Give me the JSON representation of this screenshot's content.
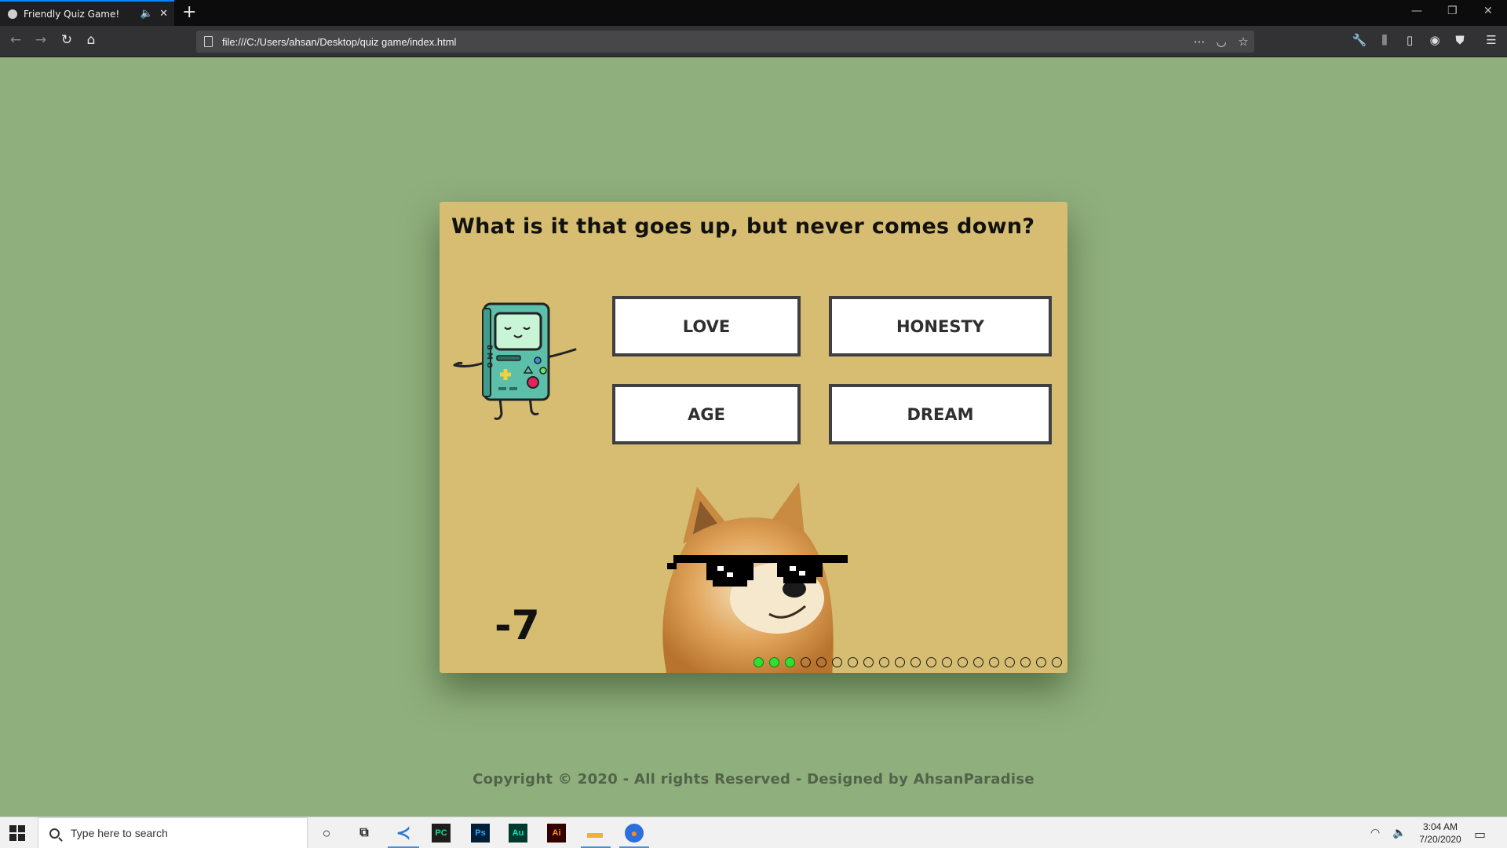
{
  "browser": {
    "tab_title": "Friendly Quiz Game!",
    "url": "file:///C:/Users/ahsan/Desktop/quiz game/index.html"
  },
  "quiz": {
    "question": "What is it that goes up, but never comes down?",
    "options": [
      "LOVE",
      "HONESTY",
      "AGE",
      "DREAM"
    ],
    "score": "-7",
    "progress": {
      "answered": 3,
      "total": 20
    },
    "colors": {
      "card": "#d6bd72",
      "background": "#8faf7c",
      "progress_done": "#2fe02f"
    }
  },
  "footer": {
    "text": "Copyright © 2020 - All rights Reserved - Designed by AhsanParadise"
  },
  "taskbar": {
    "search_placeholder": "Type here to search",
    "apps": [
      "cortana-icon",
      "task-view-icon",
      "vscode-icon",
      "pycharm-icon",
      "photoshop-icon",
      "audition-icon",
      "illustrator-icon",
      "file-explorer-icon",
      "firefox-icon"
    ],
    "app_labels": {
      "pycharm": "PC",
      "photoshop": "Ps",
      "audition": "Au",
      "illustrator": "Ai"
    },
    "time": "3:04 AM",
    "date": "7/20/2020"
  }
}
